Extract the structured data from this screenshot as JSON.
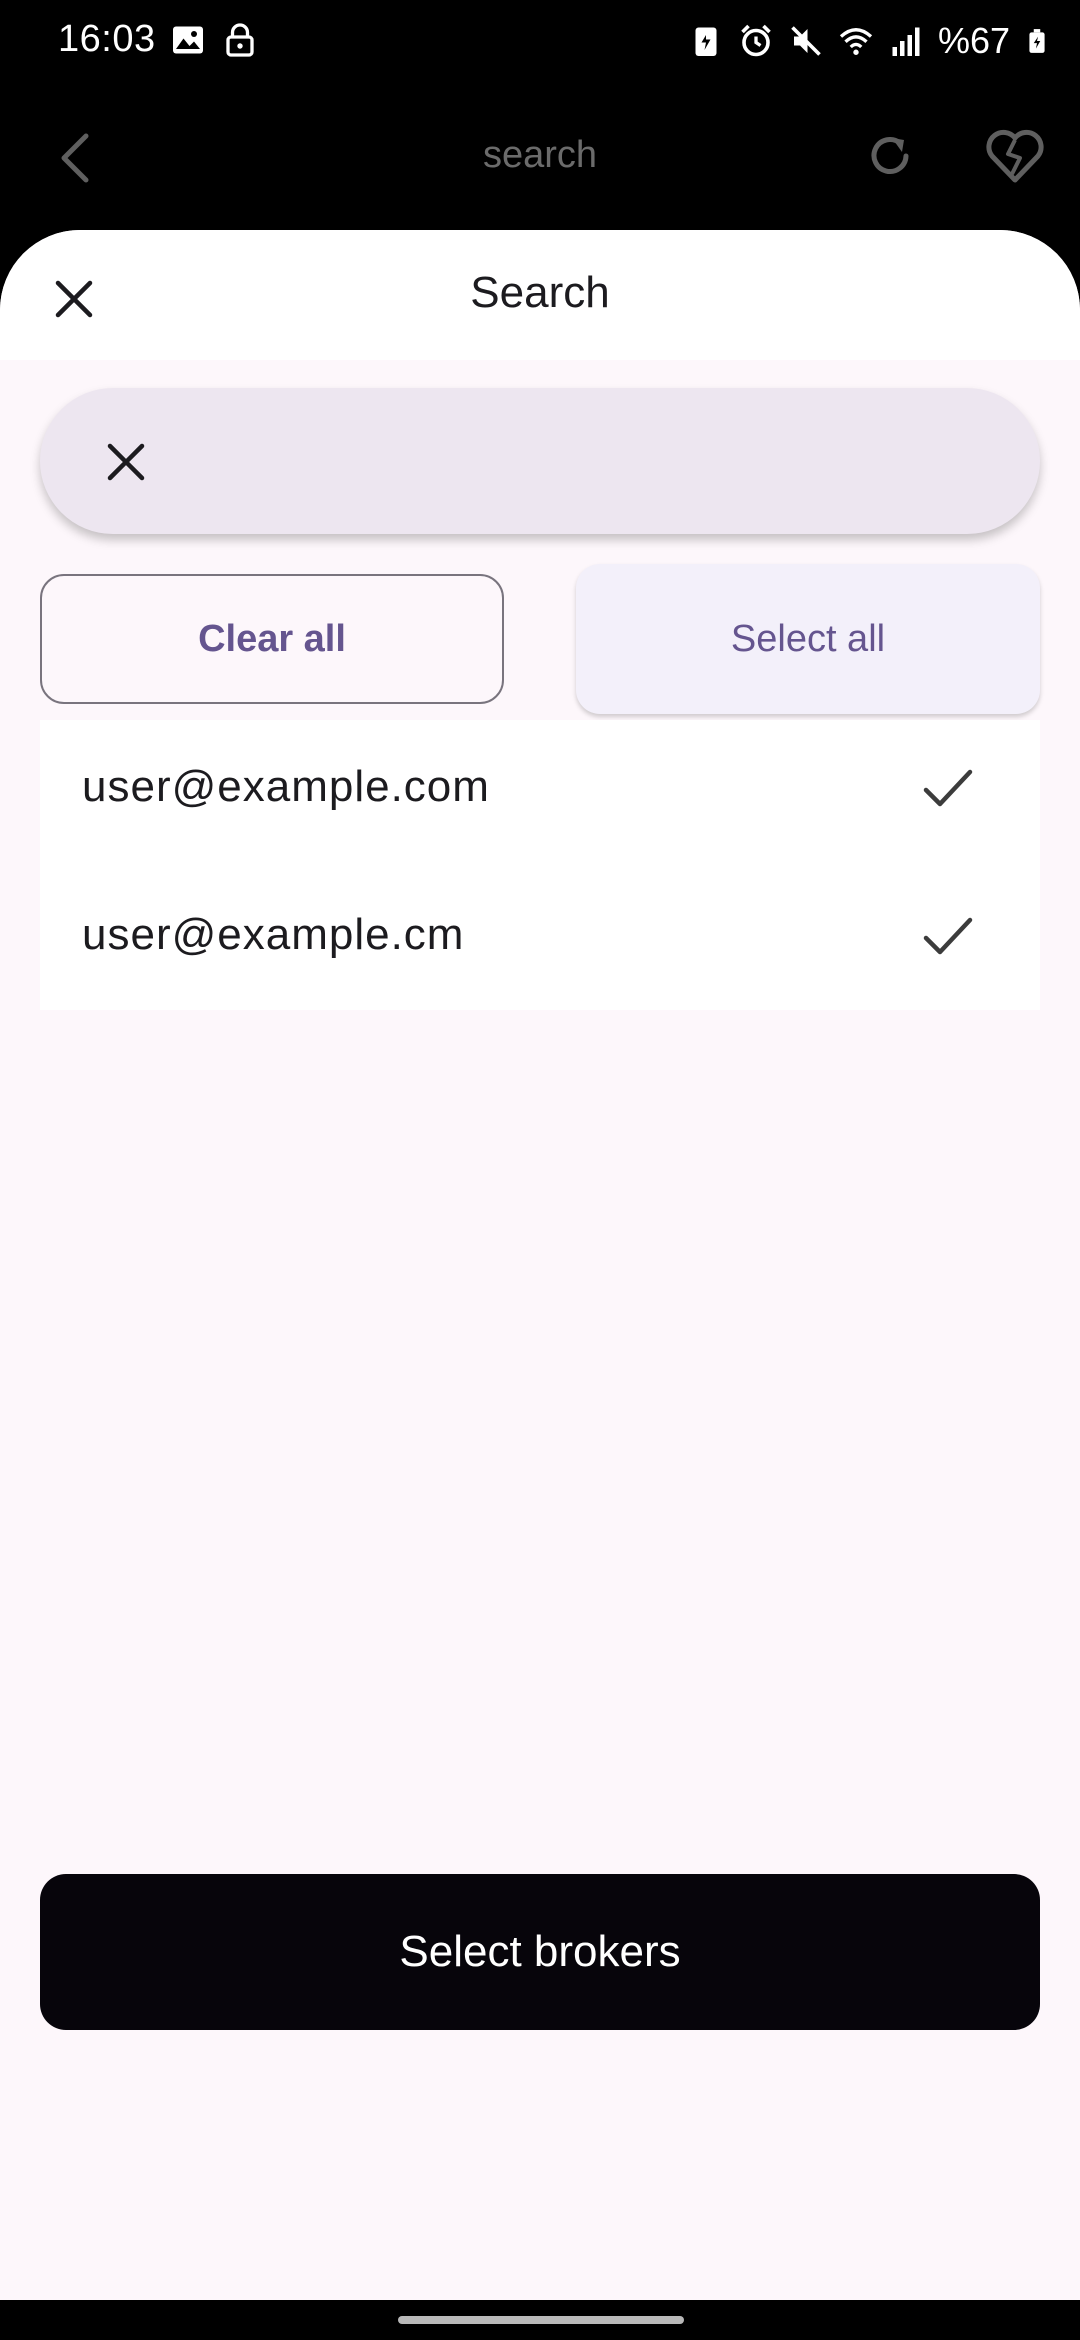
{
  "status_bar": {
    "time": "16:03",
    "battery_text": "%67",
    "icons_left": [
      "image-icon",
      "lock-icon"
    ],
    "icons_right": [
      "battery-saver-icon",
      "alarm-icon",
      "mute-icon",
      "wifi-icon",
      "signal-icon",
      "battery-icon"
    ]
  },
  "app_bar": {
    "title": "search",
    "icons": [
      "back-icon",
      "refresh-icon",
      "broken-heart-icon"
    ]
  },
  "sheet": {
    "title": "Search",
    "search": {
      "value": "",
      "placeholder": ""
    },
    "clear_all_label": "Clear all",
    "select_all_label": "Select all",
    "items": [
      {
        "label": "user@example.com",
        "checked": true
      },
      {
        "label": "user@example.cm",
        "checked": true
      }
    ],
    "primary_label": "Select brokers"
  },
  "colors": {
    "accent": "#65558f",
    "sheet_bg": "#fdf7fb",
    "search_bg": "#ede6f0",
    "primary_bg": "#07050b"
  }
}
